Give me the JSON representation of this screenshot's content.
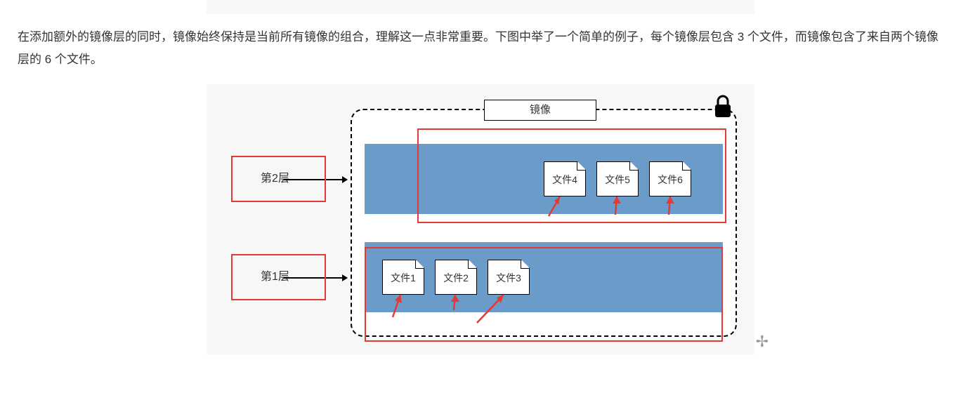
{
  "paragraph": "在添加额外的镜像层的同时，镜像始终保持是当前所有镜像的组合，理解这一点非常重要。下图中举了一个简单的例子，每个镜像层包含 3 个文件，而镜像包含了来自两个镜像层的 6 个文件。",
  "diagram": {
    "title": "镜像",
    "layers": [
      {
        "label": "第2层",
        "files": [
          "文件4",
          "文件5",
          "文件6"
        ]
      },
      {
        "label": "第1层",
        "files": [
          "文件1",
          "文件2",
          "文件3"
        ]
      }
    ],
    "lock_icon": "lock-icon"
  },
  "annotations": {
    "red_boxes": [
      "layer2-label",
      "layer1-label",
      "layer2-files",
      "layer1-files"
    ],
    "red_arrows_count": 6
  },
  "colors": {
    "layer_fill": "#6a9bc9",
    "annotation": "#e53935",
    "figure_bg": "#f7f7f7"
  }
}
